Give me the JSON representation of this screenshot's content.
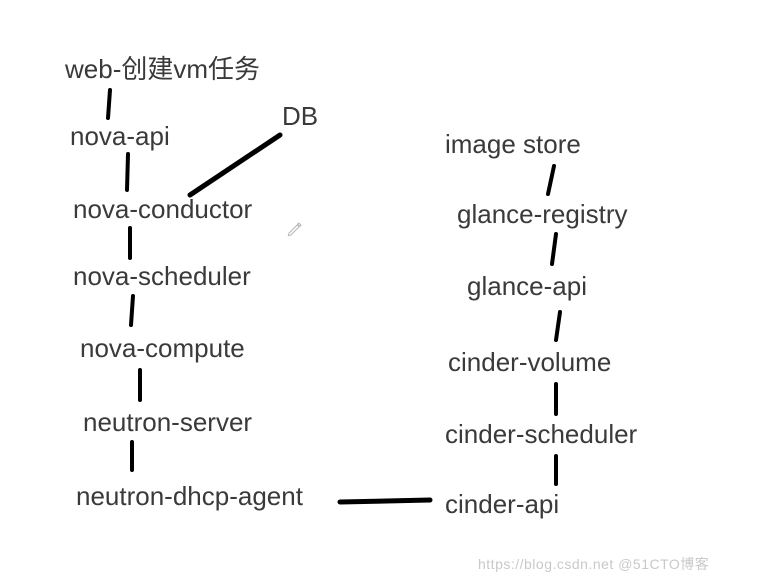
{
  "diagram": {
    "left": {
      "n0": "web-创建vm任务",
      "n1": "nova-api",
      "n2": "nova-conductor",
      "n3": "nova-scheduler",
      "n4": "nova-compute",
      "n5": "neutron-server",
      "n6": "neutron-dhcp-agent",
      "db": "DB"
    },
    "right": {
      "r0": "image store",
      "r1": "glance-registry",
      "r2": "glance-api",
      "r3": "cinder-volume",
      "r4": "cinder-scheduler",
      "r5": "cinder-api"
    }
  },
  "icons": {
    "pencil": "pencil-icon"
  },
  "watermark": "https://blog.csdn.net  @51CTO博客"
}
